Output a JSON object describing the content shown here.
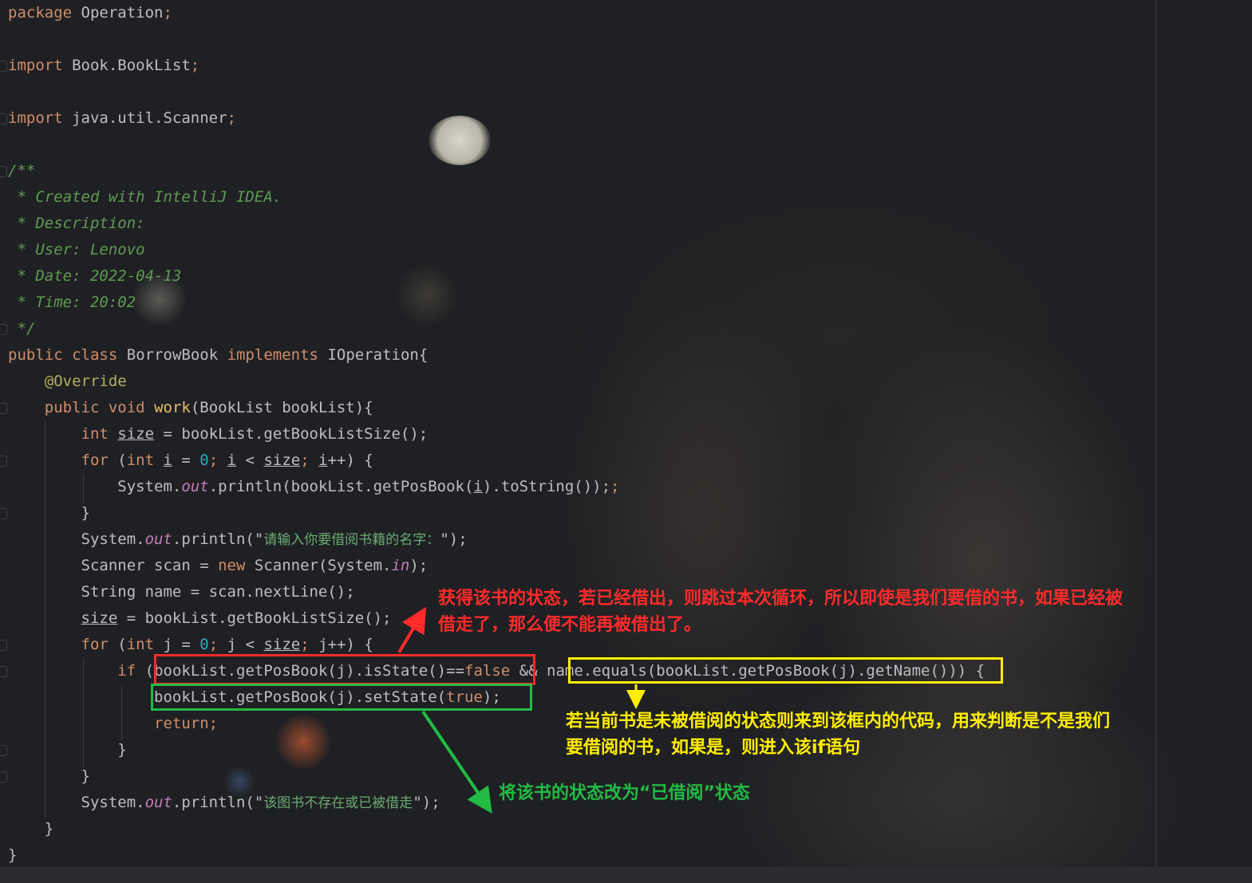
{
  "code": {
    "package_kw": "package",
    "package_name": " Operation",
    "import1_kw": "import",
    "import1_name": " Book.BookList",
    "import2_kw": "import",
    "import2_name": " java.util.Scanner",
    "semicolon": ";",
    "comment": [
      "/**",
      " * Created with IntelliJ IDEA.",
      " * Description:",
      " * User: Lenovo",
      " * Date: 2022-04-13",
      " * Time: 20:02",
      " */"
    ],
    "class_public": "public",
    "class_kw": "class",
    "class_name": "BorrowBook",
    "implements_kw": "implements",
    "interface_name": "IOperation{",
    "override": "@Override",
    "method_public": "public",
    "method_void": "void",
    "method_name": "work",
    "method_params": "(BookList bookList){",
    "int_kw": "int",
    "size_var": "size",
    "size_assign": " = bookList.getBookListSize();",
    "for_kw": "for",
    "i_var": "i",
    "j_var": "j",
    "zero": "0",
    "tostring_call": "System.",
    "out_field": "out",
    "println_i_a": ".println(bookList.getPosBook(",
    "println_i_b": ").toString());",
    "close_brace": "}",
    "println_prompt_a": ".println(\"",
    "prompt_text": "请输入你要借阅书籍的名字：",
    "println_prompt_b": "\");",
    "scanner_a": "Scanner scan = ",
    "new_kw": "new",
    "scanner_b": " Scanner(System.",
    "in_field": "in",
    "scanner_c": ");",
    "string_line": "String name = scan.nextLine();",
    "if_kw": "if",
    "cond1_a": "bookList.getPosBook(",
    "cond1_b": ").isState()==",
    "false_kw": "false",
    "and_op": "&&",
    "cond2_a": "name.equals(bookList.getPosBook(",
    "cond2_b": ").getName())",
    "if_tail": ") {",
    "setstate_a": "bookList.getPosBook(",
    "setstate_b": ").setState(",
    "true_kw": "true",
    "setstate_c": ");",
    "return_kw": "return",
    "fail_text": "该图书不存在或已被借走"
  },
  "annotations": {
    "red_note": "获得该书的状态，若已经借出，则跳过本次循环，所以即使是我们要借的书，如果已经被\n借走了，那么便不能再被借出了。",
    "yellow_note": "若当前书是未被借阅的状态则来到该框内的代码，用来判断是不是我们\n要借阅的书，如果是，则进入该if语句",
    "green_note": "将该书的状态改为“已借阅”状态",
    "colors": {
      "red": "#ff2a2a",
      "yellow": "#ffee00",
      "green": "#22bb44"
    }
  }
}
